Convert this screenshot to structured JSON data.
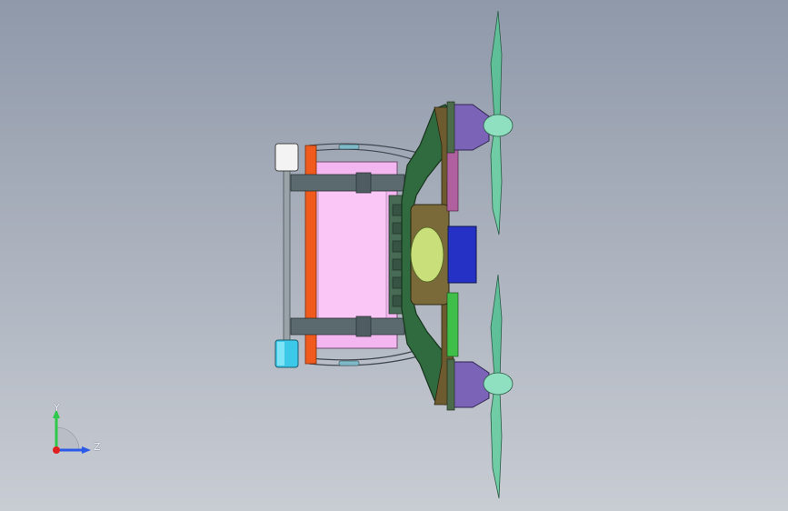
{
  "viewport": {
    "background_top": "#8f99aa",
    "background_bottom": "#c8ccd3"
  },
  "model": {
    "parts": [
      {
        "name": "propeller-top",
        "color": "#5fbf98"
      },
      {
        "name": "propeller-bottom",
        "color": "#5fbf98"
      },
      {
        "name": "motor-top",
        "color": "#7b63b8"
      },
      {
        "name": "motor-bottom",
        "color": "#7b63b8"
      },
      {
        "name": "body-frame",
        "color": "#2f6b3e"
      },
      {
        "name": "battery-pack",
        "color": "#f4b6f0"
      },
      {
        "name": "orange-rail",
        "color": "#f05a1c"
      },
      {
        "name": "center-lens",
        "color": "#c9e07a"
      },
      {
        "name": "blue-module",
        "color": "#2530c4"
      },
      {
        "name": "white-roller",
        "color": "#f3f3f3"
      },
      {
        "name": "cyan-roller",
        "color": "#3cc8e8"
      }
    ]
  },
  "triad": {
    "y_label": "Y",
    "z_label": "Z",
    "y_color": "#2ec84a",
    "z_color": "#2b59e8",
    "x_color": "#e02020"
  }
}
